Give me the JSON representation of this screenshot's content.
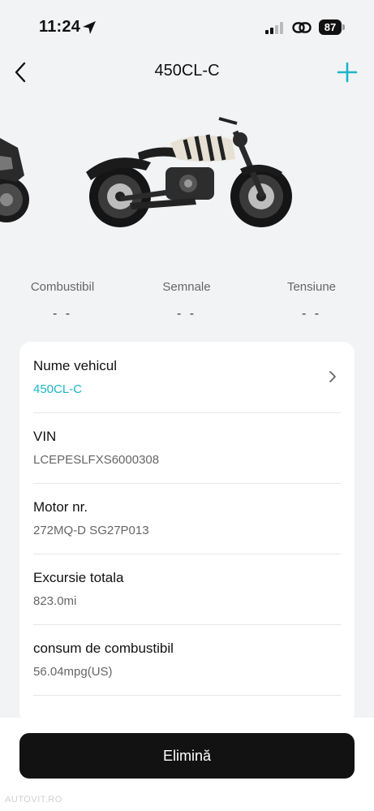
{
  "status_bar": {
    "time": "11:24",
    "battery": "87"
  },
  "header": {
    "title": "450CL-C"
  },
  "stats": [
    {
      "label": "Combustibil",
      "value": "- -"
    },
    {
      "label": "Semnale",
      "value": "- -"
    },
    {
      "label": "Tensiune",
      "value": "- -"
    }
  ],
  "details": [
    {
      "label": "Nume vehicul",
      "value": "450CL-C"
    },
    {
      "label": "VIN",
      "value": "LCEPESLFXS6000308"
    },
    {
      "label": "Motor nr.",
      "value": "272MQ-D SG27P013"
    },
    {
      "label": "Excursie totala",
      "value": "823.0mi"
    },
    {
      "label": "consum de combustibil",
      "value": "56.04mpg(US)"
    }
  ],
  "footer": {
    "delete_label": "Elimină"
  },
  "watermark": "AUTOVIT.RO",
  "colors": {
    "accent": "#1bb6c7",
    "button": "#121212",
    "background": "#f2f3f5"
  }
}
